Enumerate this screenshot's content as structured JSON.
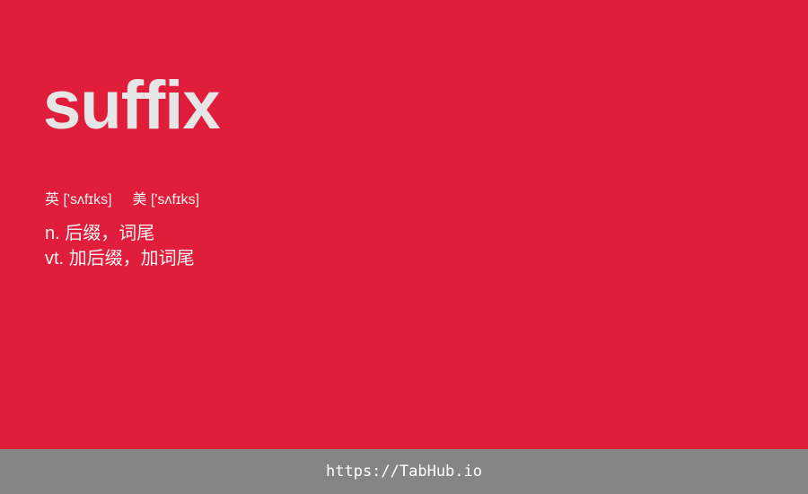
{
  "card": {
    "word": "suffix",
    "phonetic_uk_label": "英",
    "phonetic_uk": "['sʌfɪks]",
    "phonetic_us_label": "美",
    "phonetic_us": "['sʌfɪks]",
    "definitions": [
      {
        "pos": "n.",
        "text": "后缀，词尾"
      },
      {
        "pos": "vt.",
        "text": "加后缀，加词尾"
      }
    ]
  },
  "footer": {
    "link_text": "https://TabHub.io"
  },
  "colors": {
    "background": "#E01E3C",
    "footer_background": "#858585",
    "word_text": "#E6E6E6"
  }
}
